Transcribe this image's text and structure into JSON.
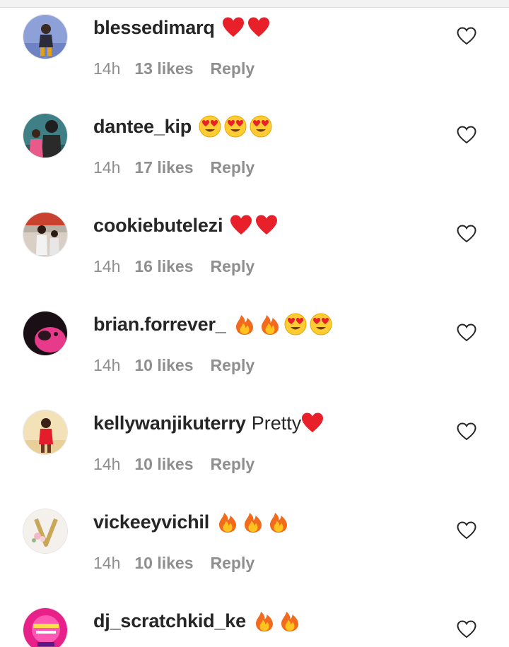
{
  "colors": {
    "username": "#262626",
    "meta": "#8e8e8e",
    "background": "#ffffff",
    "heart_red": "#e8202a"
  },
  "comments": [
    {
      "username": "blessedimarq",
      "text": "",
      "emojis": [
        "red-heart",
        "red-heart"
      ],
      "time": "14h",
      "likes": "13 likes",
      "reply": "Reply",
      "like_icon": "heart-outline-icon"
    },
    {
      "username": "dantee_kip",
      "text": "",
      "emojis": [
        "heart-eyes",
        "heart-eyes",
        "heart-eyes"
      ],
      "time": "14h",
      "likes": "17 likes",
      "reply": "Reply",
      "like_icon": "heart-outline-icon"
    },
    {
      "username": "cookiebutelezi",
      "text": "",
      "emojis": [
        "red-heart",
        "red-heart"
      ],
      "time": "14h",
      "likes": "16 likes",
      "reply": "Reply",
      "like_icon": "heart-outline-icon"
    },
    {
      "username": "brian.forrever_",
      "text": "",
      "emojis": [
        "fire",
        "fire",
        "heart-eyes",
        "heart-eyes"
      ],
      "time": "14h",
      "likes": "10 likes",
      "reply": "Reply",
      "like_icon": "heart-outline-icon"
    },
    {
      "username": "kellywanjikuterry",
      "text": "Pretty",
      "emojis": [
        "red-heart"
      ],
      "time": "14h",
      "likes": "10 likes",
      "reply": "Reply",
      "like_icon": "heart-outline-icon"
    },
    {
      "username": "vickeeyvichil",
      "text": "",
      "emojis": [
        "fire",
        "fire",
        "fire"
      ],
      "time": "14h",
      "likes": "10 likes",
      "reply": "Reply",
      "like_icon": "heart-outline-icon"
    },
    {
      "username": "dj_scratchkid_ke",
      "text": "",
      "emojis": [
        "fire",
        "fire"
      ],
      "time": "",
      "likes": "",
      "reply": "",
      "like_icon": "heart-outline-icon"
    }
  ]
}
